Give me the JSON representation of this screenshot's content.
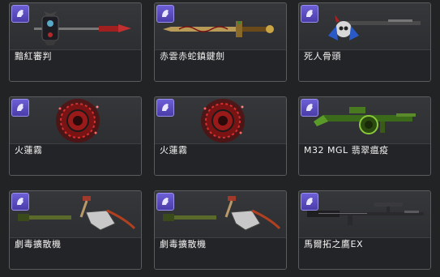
{
  "items": [
    {
      "name": "黯紅審判",
      "weapon": "dark-red-spear",
      "grade_icon": "horse-head-icon"
    },
    {
      "name": "赤雲赤蛇鎮鍵劍",
      "weapon": "red-serpent-sword",
      "grade_icon": "horse-head-icon"
    },
    {
      "name": "死人骨頭",
      "weapon": "skull-rifle",
      "grade_icon": "horse-head-icon"
    },
    {
      "name": "火蓮霧",
      "weapon": "fire-lotus-grenade",
      "grade_icon": "horse-head-icon"
    },
    {
      "name": "火蓮霧",
      "weapon": "fire-lotus-grenade",
      "grade_icon": "horse-head-icon"
    },
    {
      "name": "M32 MGL 翡翠瘟疫",
      "weapon": "green-grenade-launcher",
      "grade_icon": "horse-head-icon"
    },
    {
      "name": "劇毒擴散機",
      "weapon": "poison-scythe-gun",
      "grade_icon": "horse-head-icon"
    },
    {
      "name": "劇毒擴散機",
      "weapon": "poison-scythe-gun",
      "grade_icon": "horse-head-icon"
    },
    {
      "name": "馬爾拓之鷹EX",
      "weapon": "sniper-rifle",
      "grade_icon": "horse-head-icon"
    }
  ],
  "colors": {
    "badge": "#5a4cc2",
    "label_text": "#f2f2f2",
    "card_bg": "#303235"
  }
}
